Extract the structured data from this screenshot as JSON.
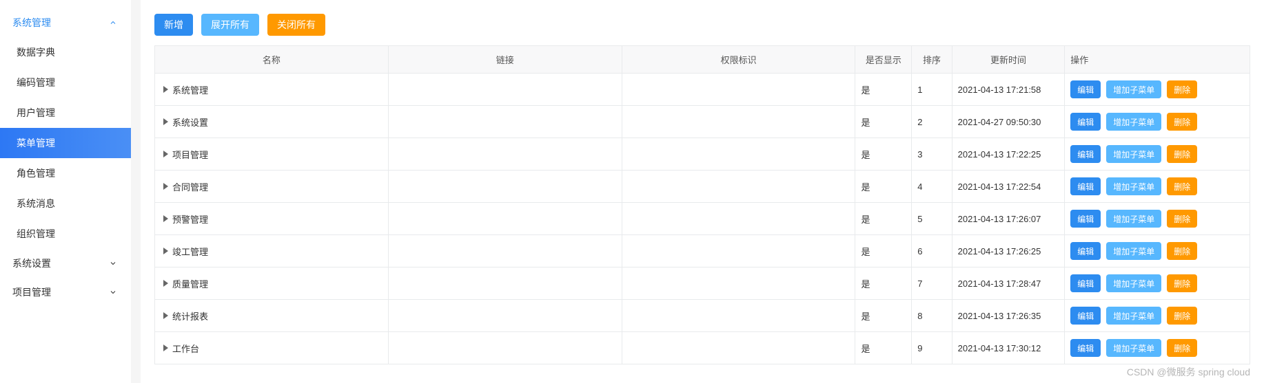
{
  "sidebar": {
    "groups": [
      {
        "label": "系统管理",
        "expanded": true,
        "items": [
          {
            "label": "数据字典",
            "active": false
          },
          {
            "label": "编码管理",
            "active": false
          },
          {
            "label": "用户管理",
            "active": false
          },
          {
            "label": "菜单管理",
            "active": true
          },
          {
            "label": "角色管理",
            "active": false
          },
          {
            "label": "系统消息",
            "active": false
          },
          {
            "label": "组织管理",
            "active": false
          }
        ]
      },
      {
        "label": "系统设置",
        "expanded": false,
        "items": []
      },
      {
        "label": "项目管理",
        "expanded": false,
        "items": []
      }
    ]
  },
  "toolbar": {
    "add": "新增",
    "expand_all": "展开所有",
    "collapse_all": "关闭所有"
  },
  "table": {
    "columns": {
      "name": "名称",
      "link": "链接",
      "perm": "权限标识",
      "show": "是否显示",
      "sort": "排序",
      "time": "更新时间",
      "ops": "操作"
    },
    "rows": [
      {
        "name": "系统管理",
        "link": "",
        "perm": "",
        "show": "是",
        "sort": "1",
        "time": "2021-04-13 17:21:58"
      },
      {
        "name": "系统设置",
        "link": "",
        "perm": "",
        "show": "是",
        "sort": "2",
        "time": "2021-04-27 09:50:30"
      },
      {
        "name": "项目管理",
        "link": "",
        "perm": "",
        "show": "是",
        "sort": "3",
        "time": "2021-04-13 17:22:25"
      },
      {
        "name": "合同管理",
        "link": "",
        "perm": "",
        "show": "是",
        "sort": "4",
        "time": "2021-04-13 17:22:54"
      },
      {
        "name": "预警管理",
        "link": "",
        "perm": "",
        "show": "是",
        "sort": "5",
        "time": "2021-04-13 17:26:07"
      },
      {
        "name": "竣工管理",
        "link": "",
        "perm": "",
        "show": "是",
        "sort": "6",
        "time": "2021-04-13 17:26:25"
      },
      {
        "name": "质量管理",
        "link": "",
        "perm": "",
        "show": "是",
        "sort": "7",
        "time": "2021-04-13 17:28:47"
      },
      {
        "name": "统计报表",
        "link": "",
        "perm": "",
        "show": "是",
        "sort": "8",
        "time": "2021-04-13 17:26:35"
      },
      {
        "name": "工作台",
        "link": "",
        "perm": "",
        "show": "是",
        "sort": "9",
        "time": "2021-04-13 17:30:12"
      }
    ],
    "ops_labels": {
      "edit": "编辑",
      "add_sub": "增加子菜单",
      "delete": "删除"
    }
  },
  "watermark": "CSDN @微服务 spring cloud"
}
